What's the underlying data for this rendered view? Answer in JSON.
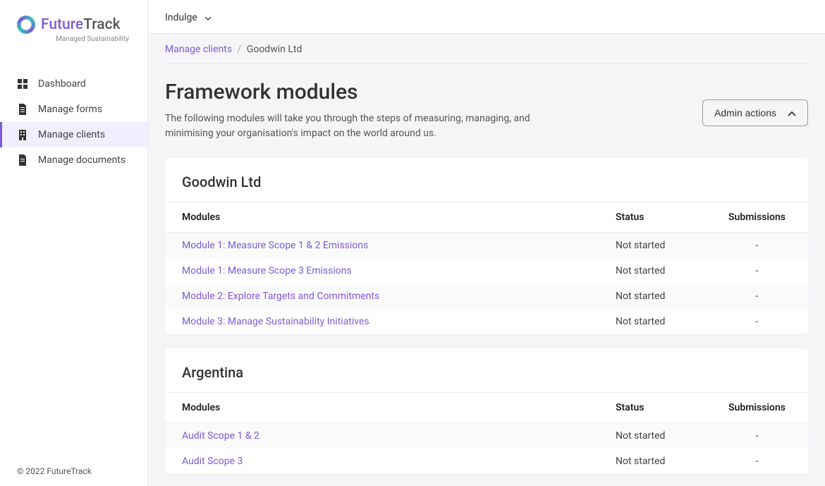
{
  "brand": {
    "name_primary": "Future",
    "name_secondary": "Track",
    "tagline": "Managed Sustainability"
  },
  "sidebar": {
    "items": [
      {
        "label": "Dashboard",
        "icon": "grid-icon"
      },
      {
        "label": "Manage forms",
        "icon": "file-icon"
      },
      {
        "label": "Manage clients",
        "icon": "building-icon"
      },
      {
        "label": "Manage documents",
        "icon": "document-icon"
      }
    ],
    "footer": "© 2022 FutureTrack"
  },
  "topbar": {
    "org_selected": "Indulge"
  },
  "breadcrumb": {
    "parent": "Manage clients",
    "current": "Goodwin Ltd"
  },
  "page": {
    "title": "Framework modules",
    "description": "The following modules will take you through the steps of measuring, managing, and minimising your organisation's impact on the world around us.",
    "admin_button": "Admin actions"
  },
  "columns": {
    "modules": "Modules",
    "status": "Status",
    "submissions": "Submissions"
  },
  "sections": [
    {
      "title": "Goodwin Ltd",
      "rows": [
        {
          "name": "Module 1: Measure Scope 1 & 2 Emissions",
          "status": "Not started",
          "submissions": "-"
        },
        {
          "name": "Module 1: Measure Scope 3 Emissions",
          "status": "Not started",
          "submissions": "-"
        },
        {
          "name": "Module 2: Explore Targets and Commitments",
          "status": "Not started",
          "submissions": "-"
        },
        {
          "name": "Module 3: Manage Sustainability Initiatives",
          "status": "Not started",
          "submissions": "-"
        }
      ]
    },
    {
      "title": "Argentina",
      "rows": [
        {
          "name": "Audit Scope 1 & 2",
          "status": "Not started",
          "submissions": "-"
        },
        {
          "name": "Audit Scope 3",
          "status": "Not started",
          "submissions": "-"
        }
      ]
    }
  ]
}
